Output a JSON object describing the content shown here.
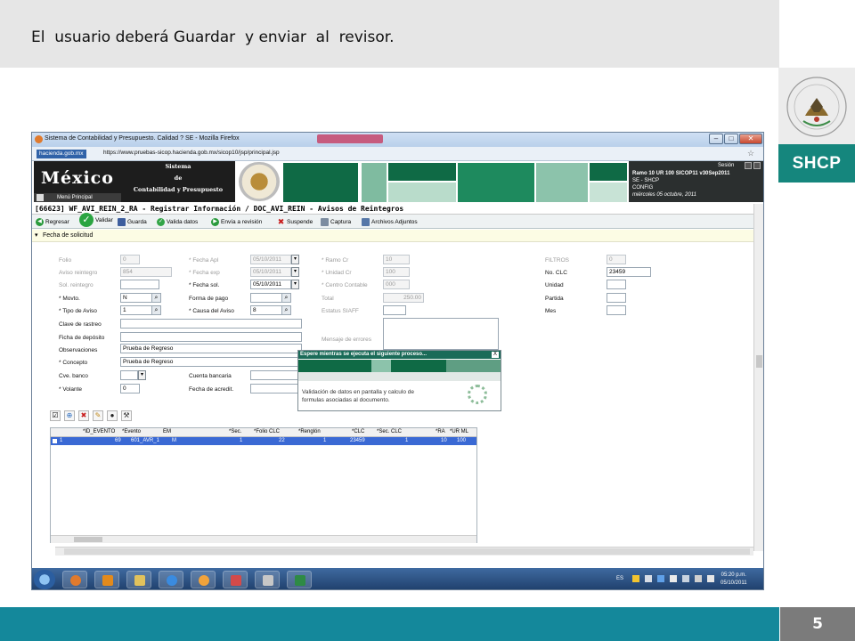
{
  "slide": {
    "title": "El  usuario deberá Guardar  y enviar  al  revisor.",
    "logo_text": "SHCP",
    "page_number": "5"
  },
  "browser": {
    "window_title": "Sistema de Contabilidad y Presupuesto. Calidad ? SE - Mozilla Firefox",
    "domain_badge": "hacienda.gob.mx",
    "url": "https://www.pruebas-sicop.hacienda.gob.mx/sicop10/jsp/principal.jsp"
  },
  "app": {
    "logo": "México",
    "menu_principal": "Menú Principal",
    "system_title": [
      "Sistema",
      "de",
      "Contabilidad y Presupuesto"
    ],
    "info_lines": [
      "Sesión",
      "Ramo 10 UR 100  SICOP11 v30Sep2011",
      "SE - SHCP",
      "CONFIG",
      "miércoles 05 octubre, 2011"
    ],
    "breadcrumb": "[66623] WF_AVI_REIN_2_RA - Registrar Información / DOC_AVI_REIN - Avisos de Reintegros",
    "date_section": "Fecha de solicitud",
    "colors": {
      "banner_dark": "#1d1d1d",
      "green_dark": "#0f6a45",
      "green_mid": "#1e8a5e",
      "green_light": "#a9d4bf",
      "selection": "#3a69d4"
    }
  },
  "toolbar": {
    "regresar": "Regresar",
    "validar": "Validar",
    "guarda": "Guarda",
    "valida_datos": "Valida datos",
    "envia": "Envía a revisión",
    "suspende": "Suspende",
    "captura": "Captura",
    "archivos": "Archivos Adjuntos"
  },
  "form": {
    "folio": {
      "label": "Folio",
      "value": "0"
    },
    "aviso_reintegro": {
      "label": "Aviso reintegro",
      "value": "854"
    },
    "sol_reintegro": {
      "label": "Sol. reintegro",
      "value": ""
    },
    "movto": {
      "label": "* Movto.",
      "value": "N"
    },
    "tipo_aviso": {
      "label": "* Tipo de Aviso",
      "value": "1"
    },
    "clave_rastreo": {
      "label": "Clave de rastreo",
      "value": ""
    },
    "ficha_deposito": {
      "label": "Ficha de depósito",
      "value": ""
    },
    "observaciones": {
      "label": "Observaciones",
      "value": "Prueba de Regreso"
    },
    "concepto": {
      "label": "* Concepto",
      "value": "Prueba de Regreso"
    },
    "cve_banco": {
      "label": "Cve. banco",
      "value": ""
    },
    "volante": {
      "label": "* Volante",
      "value": "0"
    },
    "fecha_apl": {
      "label": "* Fecha Apl",
      "value": "05/10/2011"
    },
    "fecha_exp": {
      "label": "* Fecha exp",
      "value": "05/10/2011"
    },
    "fecha_sol": {
      "label": "* Fecha sol.",
      "value": "05/10/2011"
    },
    "forma_pago": {
      "label": "Forma de pago",
      "value": ""
    },
    "causa_aviso": {
      "label": "* Causa del Aviso",
      "value": "8"
    },
    "cuenta_bancaria": {
      "label": "Cuenta bancaria",
      "value": ""
    },
    "fecha_acredit": {
      "label": "Fecha de acredit.",
      "value": ""
    },
    "ramo_cr": {
      "label": "* Ramo Cr",
      "value": "10"
    },
    "unidad_cr": {
      "label": "* Unidad Cr",
      "value": "100"
    },
    "centro_contable": {
      "label": "* Centro Contable",
      "value": "000"
    },
    "total": {
      "label": "Total",
      "value": "250.00"
    },
    "estatus_siaff": {
      "label": "Estatus SIAFF",
      "value": ""
    },
    "mensaje_errores": {
      "label": "Mensaje de errores",
      "value": ""
    },
    "filtros": {
      "label": "FILTROS",
      "value": "0"
    },
    "no_clc": {
      "label": "No. CLC",
      "value": "23459"
    },
    "unidad": {
      "label": "Unidad",
      "value": ""
    },
    "partida": {
      "label": "Partida",
      "value": ""
    },
    "mes": {
      "label": "Mes",
      "value": ""
    }
  },
  "modal": {
    "title": "Espere mientras se ejecuta el siguiente proceso...",
    "close": "X",
    "message_1": "Validación de datos en pantalla y calculo de",
    "message_2": "formulas asociadas al documento."
  },
  "grid": {
    "headers": [
      "*ID_EVENTO",
      "*Evento",
      "EM",
      "*Sec.",
      "*Folio CLC",
      "*Renglón",
      "*CLC",
      "*Sec. CLC",
      "*RA",
      "*UR ML"
    ],
    "row": [
      "1",
      "69",
      "601_AVR_1",
      "M",
      "1",
      "22",
      "1",
      "23459",
      "1",
      "10",
      "100"
    ]
  },
  "taskbar": {
    "lang": "ES",
    "time": "05:20 p.m.",
    "date": "05/10/2011"
  }
}
